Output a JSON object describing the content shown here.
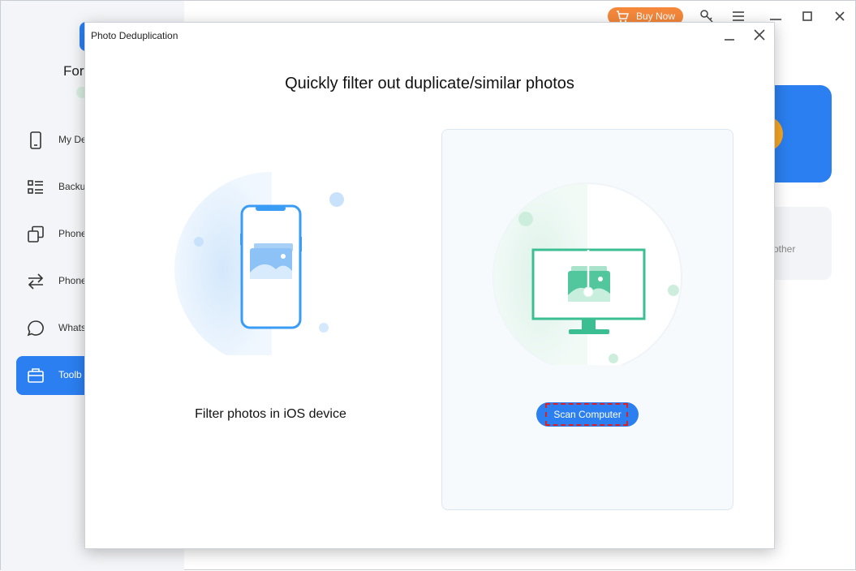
{
  "app": {
    "name": "For",
    "buy_now": "Buy Now",
    "nav_items": [
      {
        "label": "My De",
        "icon": "phone-icon"
      },
      {
        "label": "Backu",
        "icon": "list-icon"
      },
      {
        "label": "Phone",
        "icon": "copy-icon"
      },
      {
        "label": "Phone",
        "icon": "transfer-arrows-icon"
      },
      {
        "label": "Whats",
        "icon": "chat-bubble-icon"
      },
      {
        "label": "Toolb",
        "icon": "toolbox-icon"
      }
    ],
    "active_nav_index": 5,
    "bg_card_text": "other"
  },
  "dialog": {
    "title": "Photo Deduplication",
    "headline": "Quickly filter out duplicate/similar photos",
    "ios_option_label": "Filter photos in iOS device",
    "scan_button_label": "Scan Computer"
  },
  "colors": {
    "accent": "#2b7ff0",
    "buy_now": "#f5883b",
    "pc_illustration": "#3bbf92",
    "ios_illustration": "#3a9cf5",
    "highlight": "#e02020"
  }
}
